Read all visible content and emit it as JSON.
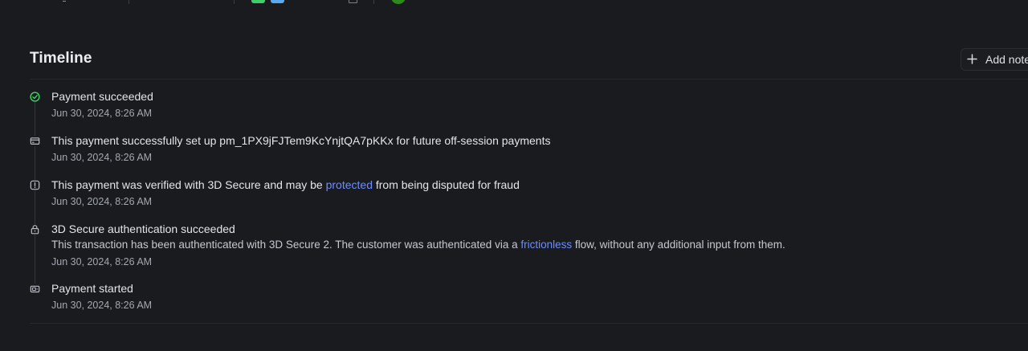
{
  "timeline": {
    "title": "Timeline",
    "add_note_label": "Add note",
    "events": [
      {
        "icon": "check-circle-icon",
        "text": "Payment succeeded",
        "timestamp": "Jun 30, 2024, 8:26 AM"
      },
      {
        "icon": "card-icon",
        "text": "This payment successfully set up pm_1PX9jFJTem9KcYnjtQA7pKKx for future off-session payments",
        "timestamp": "Jun 30, 2024, 8:26 AM"
      },
      {
        "icon": "info-icon",
        "text_before": "This payment was verified with 3D Secure and may be ",
        "link": "protected",
        "text_after": " from being disputed for fraud",
        "timestamp": "Jun 30, 2024, 8:26 AM"
      },
      {
        "icon": "lock-icon",
        "text": "3D Secure authentication succeeded",
        "desc_before": "This transaction has been authenticated with 3D Secure 2. The customer was authenticated via a ",
        "link": "frictionless",
        "desc_after": " flow, without any additional input from them.",
        "timestamp": "Jun 30, 2024, 8:26 AM"
      },
      {
        "icon": "payment-started-icon",
        "text": "Payment started",
        "timestamp": "Jun 30, 2024, 8:26 AM"
      }
    ]
  },
  "colors": {
    "background": "#1a1b1f",
    "success": "#3dd668",
    "link": "#6e8dff",
    "top_chip_green": "#3ecf6a",
    "top_chip_blue": "#5aa9f0",
    "top_dot_green": "#2f8a1e"
  }
}
